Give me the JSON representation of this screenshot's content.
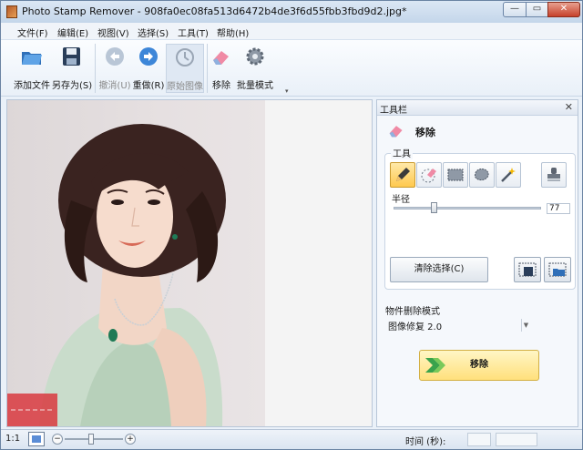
{
  "window": {
    "title": "Photo Stamp Remover - 908fa0ec08fa513d6472b4de3f6d55fbb3fbd9d2.jpg*",
    "min_glyph": "—",
    "max_glyph": "▭",
    "close_glyph": "✕"
  },
  "menu": [
    "文件(F)",
    "编辑(E)",
    "视图(V)",
    "选择(S)",
    "工具(T)",
    "帮助(H)"
  ],
  "toolbar": {
    "add_file": "添加文件",
    "save_as": "另存为(S)",
    "undo": "撤消(U)",
    "redo": "重做(R)",
    "original": "原始图像",
    "remove": "移除",
    "batch": "批量模式",
    "more_glyph": "▾"
  },
  "panel": {
    "header": "工具栏",
    "close_glyph": "✕",
    "mode_title": "移除",
    "tools_label": "工具",
    "radius_label": "半径",
    "radius_value": "77",
    "radius_fraction": 0.27,
    "clear_button": "清除选择(C)",
    "object_mode_label": "物件删除模式",
    "object_mode_value": "图像修复 2.0",
    "remove_button": "移除"
  },
  "status": {
    "zoom_ratio": "1:1",
    "zoom_fraction": 0.45,
    "time_label": "时间 (秒):"
  },
  "colors": {
    "accent": "#5b8dd6",
    "remove_button": "#ffe07c",
    "active_tool": "#ffc94e"
  }
}
